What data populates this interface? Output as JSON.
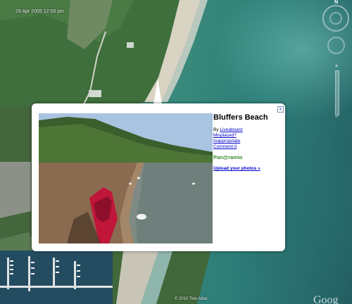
{
  "map": {
    "datetime": "29 Apr 2009 12:58 pm",
    "copyright": "© 2010 Tele Atlas",
    "google_logo": "Goog",
    "north_label": "N",
    "zoom_in": "+",
    "zoom_out": "−"
  },
  "balloon": {
    "title": "Bluffers Beach",
    "by_prefix": "By",
    "author": "Liveaboard",
    "misplaced": "Misplaced?",
    "inappropriate": "Inappropriate",
    "comment": "Comment it",
    "brand": "Pan@ramio",
    "upload": "Upload your photos »",
    "close": "x"
  },
  "colors": {
    "link": "#0000cc",
    "brand": "#3a8f2a",
    "water": "#2d7d78"
  }
}
